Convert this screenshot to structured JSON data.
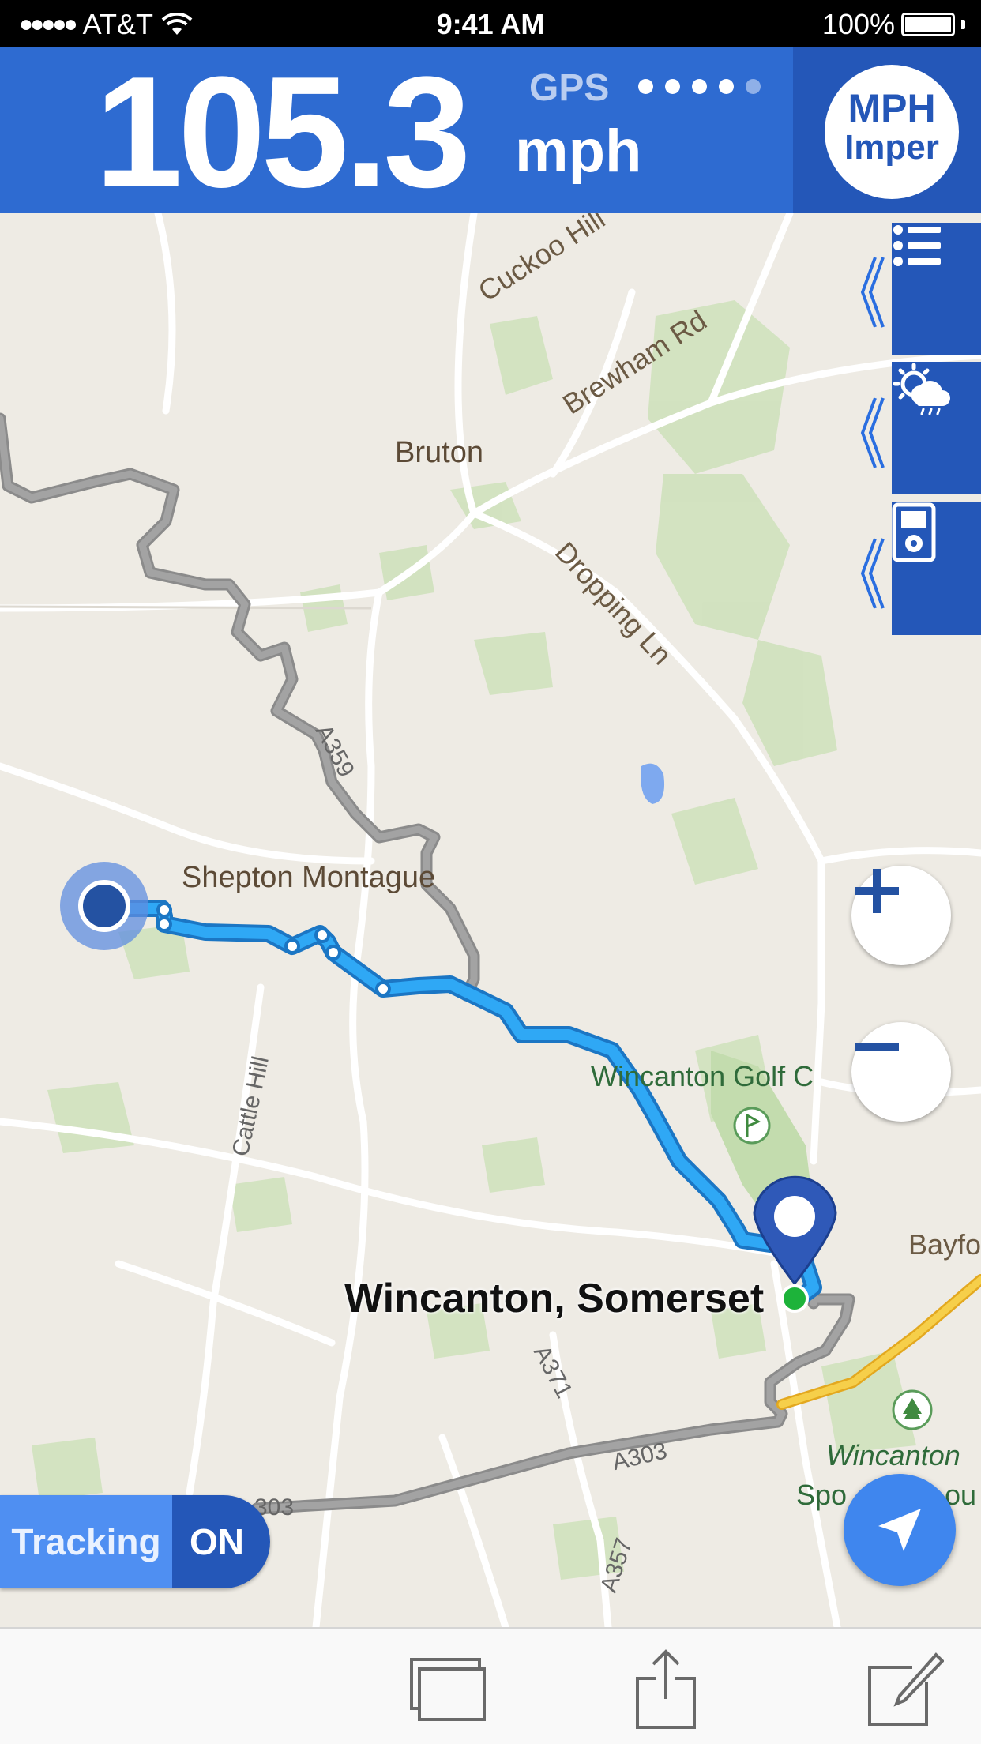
{
  "status_bar": {
    "signal_dots": "●●●●●",
    "carrier": "AT&T",
    "time": "9:41 AM",
    "battery": "100%"
  },
  "speed": {
    "value": "105.3",
    "gps_label": "GPS",
    "unit": "mph",
    "gps_signal_bars": 5,
    "gps_signal_active": 4
  },
  "unit_toggle": {
    "line1": "MPH",
    "line2": "Imper"
  },
  "side_panel": {
    "buttons": [
      "list-icon",
      "weather-icon",
      "music-player-icon"
    ]
  },
  "map": {
    "labels": {
      "bruton": "Bruton",
      "cuckoo_hill": "Cuckoo Hill",
      "brewham_rd": "Brewham Rd",
      "dropping_ln": "Dropping Ln",
      "a359": "A359",
      "shepton_montague": "Shepton Montague",
      "cattle_hill": "Cattle Hill",
      "wincanton_golf": "Wincanton Golf C",
      "bayford": "Bayfo",
      "destination": "Wincanton, Somerset",
      "a371": "A371",
      "a303": "A303",
      "a303_left": "303",
      "a357": "A357",
      "wincanton_sport_1": "Wincanton",
      "wincanton_sport_2": "Spo",
      "wincanton_sport_3": "ou"
    },
    "colors": {
      "route": "#1e9cf0",
      "road": "#9d9d9d",
      "motorway": "#f3c12e",
      "accent": "#2457b8"
    }
  },
  "controls": {
    "zoom_in": "+",
    "zoom_out": "−",
    "tracking_label": "Tracking",
    "tracking_state": "ON"
  },
  "toolbar": {
    "buttons": [
      "tabs-icon",
      "share-icon",
      "compose-icon"
    ]
  }
}
